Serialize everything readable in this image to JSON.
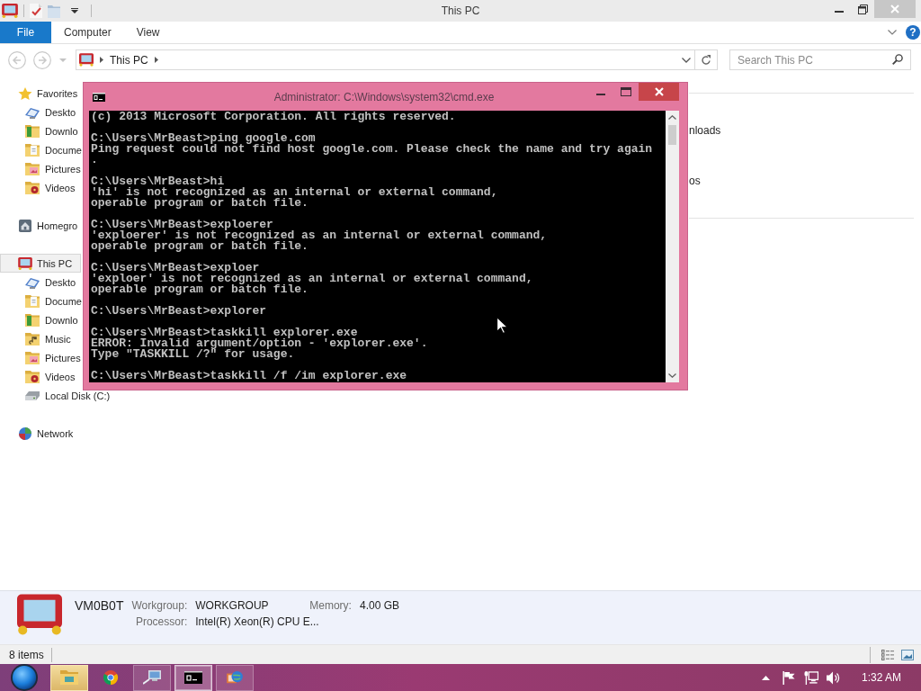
{
  "explorer": {
    "title": "This PC",
    "tabs": [
      {
        "label": "File",
        "kind": "file"
      },
      {
        "label": "Computer",
        "kind": "tab"
      },
      {
        "label": "View",
        "kind": "tab"
      }
    ],
    "help_label": "?",
    "address": {
      "crumbs": [
        "This PC"
      ],
      "search_placeholder": "Search This PC"
    },
    "nav_tree": [
      {
        "label": "Favorites",
        "kind": "favorites",
        "selected": false,
        "children": [
          {
            "label": "Deskto",
            "kind": "desktop",
            "selected": false
          },
          {
            "label": "Downlo",
            "kind": "downloads",
            "selected": false
          },
          {
            "label": "Docume",
            "kind": "documents",
            "selected": false
          },
          {
            "label": "Pictures",
            "kind": "pictures",
            "selected": false
          },
          {
            "label": "Videos",
            "kind": "videos",
            "selected": false
          }
        ]
      },
      {
        "label": "Homegro",
        "kind": "homegroup",
        "selected": false
      },
      {
        "label": "This PC",
        "kind": "computer",
        "selected": true,
        "children": [
          {
            "label": "Deskto",
            "kind": "desktop",
            "selected": false
          },
          {
            "label": "Docume",
            "kind": "documents",
            "selected": false
          },
          {
            "label": "Downlo",
            "kind": "downloads",
            "selected": false
          },
          {
            "label": "Music",
            "kind": "music",
            "selected": false
          },
          {
            "label": "Pictures",
            "kind": "pictures",
            "selected": false
          },
          {
            "label": "Videos",
            "kind": "videos",
            "selected": false
          },
          {
            "label": "Local Disk (C:)",
            "kind": "drive",
            "selected": false
          }
        ]
      },
      {
        "label": "Network",
        "kind": "network",
        "selected": false
      }
    ],
    "content": {
      "items": [
        "nloads",
        "os"
      ]
    },
    "details": {
      "name": "VM0B0T",
      "rows": [
        [
          {
            "label": "Workgroup:",
            "value": "WORKGROUP"
          },
          {
            "label": "Memory:",
            "value": "4.00 GB"
          }
        ],
        [
          {
            "label": "Processor:",
            "value": "Intel(R) Xeon(R) CPU E..."
          }
        ]
      ]
    },
    "status_bar": {
      "item_count": "8 items"
    }
  },
  "console_window": {
    "title": "Administrator: C:\\Windows\\system32\\cmd.exe",
    "blocks": [
      [
        "(c) 2013 Microsoft Corporation. All rights reserved."
      ],
      [
        "C:\\Users\\MrBeast>ping google.com",
        "Ping request could not find host google.com. Please check the name and try again",
        "."
      ],
      [
        "C:\\Users\\MrBeast>hi",
        "'hi' is not recognized as an internal or external command,",
        "operable program or batch file."
      ],
      [
        "C:\\Users\\MrBeast>exploerer",
        "'exploerer' is not recognized as an internal or external command,",
        "operable program or batch file."
      ],
      [
        "C:\\Users\\MrBeast>exploer",
        "'exploer' is not recognized as an internal or external command,",
        "operable program or batch file."
      ],
      [
        "C:\\Users\\MrBeast>explorer"
      ],
      [
        "C:\\Users\\MrBeast>taskkill explorer.exe",
        "ERROR: Invalid argument/option - 'explorer.exe'.",
        "Type \"TASKKILL /?\" for usage."
      ],
      [
        "C:\\Users\\MrBeast>taskkill /f /im explorer.exe"
      ]
    ]
  },
  "taskbar": {
    "buttons": [
      {
        "kind": "explorer",
        "hovered": true,
        "running": false,
        "selected": false
      },
      {
        "kind": "browser",
        "hovered": false,
        "running": false,
        "selected": false
      },
      {
        "kind": "remote",
        "hovered": false,
        "running": true,
        "selected": false
      },
      {
        "kind": "console",
        "hovered": false,
        "running": true,
        "selected": true
      },
      {
        "kind": "control_panel",
        "hovered": false,
        "running": true,
        "selected": false
      }
    ],
    "clock": "1:32 AM"
  }
}
